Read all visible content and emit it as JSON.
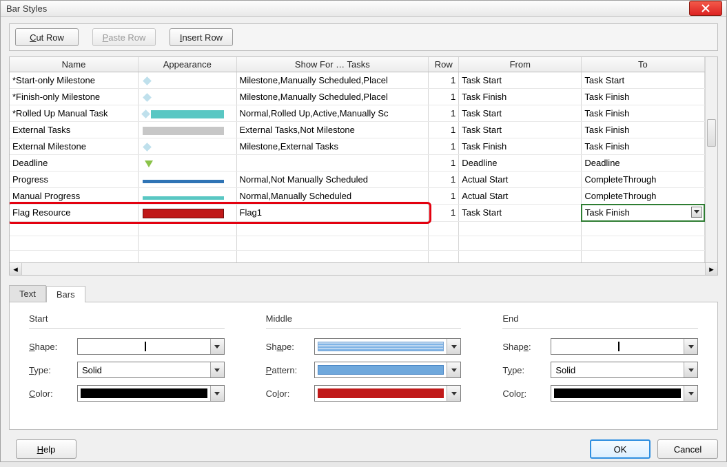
{
  "title": "Bar Styles",
  "toolbar": {
    "cut": "Cut Row",
    "paste": "Paste Row",
    "insert": "Insert Row"
  },
  "grid": {
    "headers": {
      "name": "Name",
      "appearance": "Appearance",
      "show": "Show For … Tasks",
      "row": "Row",
      "from": "From",
      "to": "To"
    },
    "rows": [
      {
        "name": "*Start-only Milestone",
        "app": "diamond",
        "show": "Milestone,Manually Scheduled,Placel",
        "row": "1",
        "from": "Task Start",
        "to": "Task Start"
      },
      {
        "name": "*Finish-only Milestone",
        "app": "diamond",
        "show": "Milestone,Manually Scheduled,Placel",
        "row": "1",
        "from": "Task Finish",
        "to": "Task Finish"
      },
      {
        "name": "*Rolled Up Manual Task",
        "app": "diamond-teal-bar",
        "show": "Normal,Rolled Up,Active,Manually Sc",
        "row": "1",
        "from": "Task Start",
        "to": "Task Finish"
      },
      {
        "name": "External Tasks",
        "app": "gray-bar",
        "show": "External Tasks,Not Milestone",
        "row": "1",
        "from": "Task Start",
        "to": "Task Finish"
      },
      {
        "name": "External Milestone",
        "app": "diamond",
        "show": "Milestone,External Tasks",
        "row": "1",
        "from": "Task Finish",
        "to": "Task Finish"
      },
      {
        "name": "Deadline",
        "app": "down-arrow",
        "show": "",
        "row": "1",
        "from": "Deadline",
        "to": "Deadline"
      },
      {
        "name": "Progress",
        "app": "thin-blue",
        "show": "Normal,Not Manually Scheduled",
        "row": "1",
        "from": "Actual Start",
        "to": "CompleteThrough"
      },
      {
        "name": "Manual Progress",
        "app": "thin-teal",
        "show": "Normal,Manually Scheduled",
        "row": "1",
        "from": "Actual Start",
        "to": "CompleteThrough"
      },
      {
        "name": "Flag Resource",
        "app": "red-bar",
        "show": "Flag1",
        "row": "1",
        "from": "Task Start",
        "to": "Task Finish",
        "selected": true
      }
    ]
  },
  "tabs": {
    "text": "Text",
    "bars": "Bars"
  },
  "panel": {
    "start_title": "Start",
    "middle_title": "Middle",
    "end_title": "End",
    "labels": {
      "shape": "Shape:",
      "type": "Type:",
      "color": "Color:",
      "pattern": "Pattern:"
    },
    "type_value": "Solid"
  },
  "footer": {
    "help": "Help",
    "ok": "OK",
    "cancel": "Cancel"
  }
}
